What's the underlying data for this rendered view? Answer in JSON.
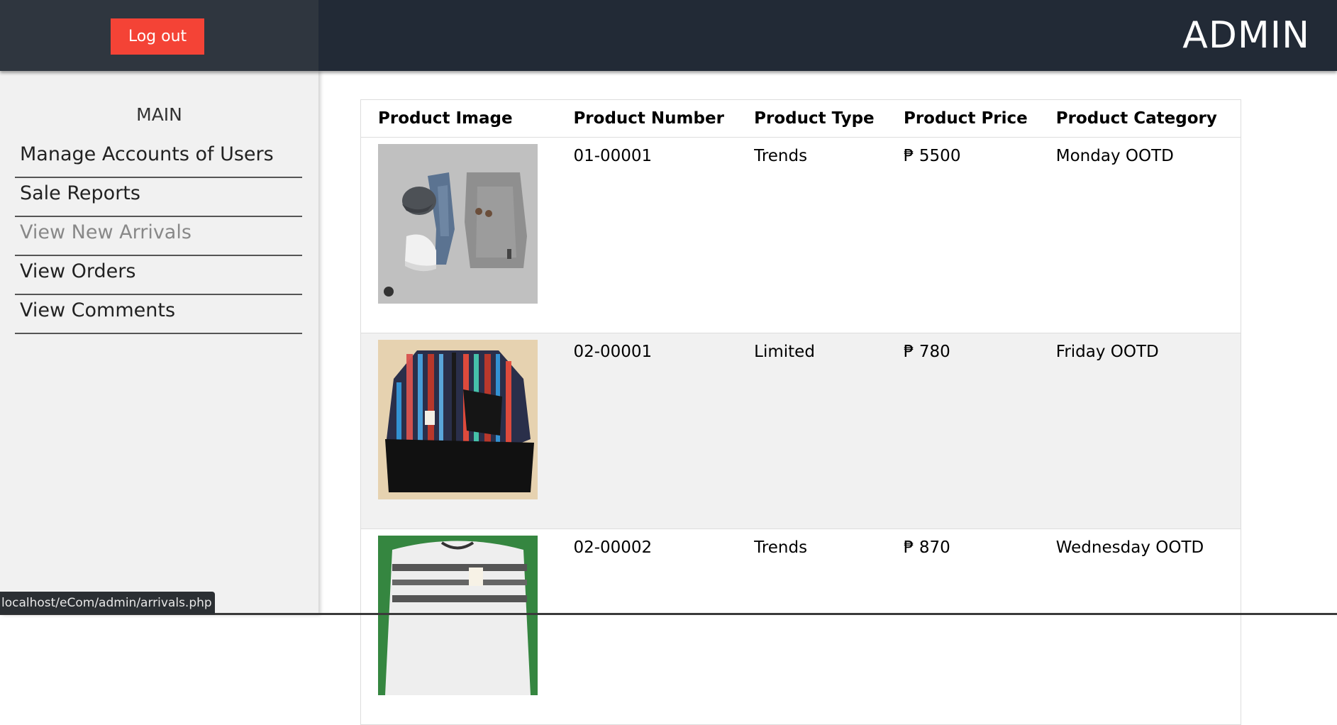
{
  "header": {
    "logout_label": "Log out",
    "brand": "ADMIN"
  },
  "sidebar": {
    "heading": "MAIN",
    "items": [
      {
        "label": "Manage Accounts of Users"
      },
      {
        "label": "Sale Reports"
      },
      {
        "label": "View New Arrivals"
      },
      {
        "label": "View Orders"
      },
      {
        "label": "View Comments"
      }
    ]
  },
  "table": {
    "headers": [
      "Product Image",
      "Product Number",
      "Product Type",
      "Product Price",
      "Product Category"
    ],
    "rows": [
      {
        "number": "01-00001",
        "type": "Trends",
        "price": "₱ 5500",
        "category": "Monday OOTD"
      },
      {
        "number": "02-00001",
        "type": "Limited",
        "price": "₱ 780",
        "category": "Friday OOTD"
      },
      {
        "number": "02-00002",
        "type": "Trends",
        "price": "₱ 870",
        "category": "Wednesday OOTD"
      }
    ]
  },
  "status_url": "localhost/eCom/admin/arrivals.php",
  "colors": {
    "topbar": "#222a36",
    "topbar_left": "#2f363f",
    "logout_button": "#f44336",
    "sidebar": "#f1f1f1",
    "alt_row": "#f1f1f1"
  }
}
